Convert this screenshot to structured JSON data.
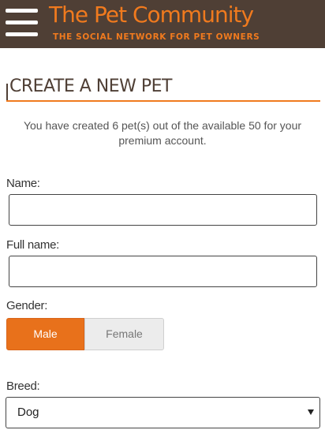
{
  "header": {
    "title": "The Pet Community",
    "tagline": "THE SOCIAL NETWORK FOR PET OWNERS",
    "menu_icon": "hamburger-menu-icon",
    "background_color": "#4f3f35",
    "accent_color": "#f07a1e"
  },
  "page": {
    "heading": "CREATE A NEW PET",
    "quota_text": "You have created 6 pet(s) out of the available 50 for your premium account."
  },
  "form": {
    "name": {
      "label": "Name:",
      "value": ""
    },
    "full_name": {
      "label": "Full name:",
      "value": ""
    },
    "gender": {
      "label": "Gender:",
      "options": [
        "Male",
        "Female"
      ],
      "selected": "Male",
      "selected_color": "#e8711b"
    },
    "breed": {
      "label": "Breed:",
      "selected": "Dog",
      "dropdown_icon": "caret-down-icon"
    }
  }
}
